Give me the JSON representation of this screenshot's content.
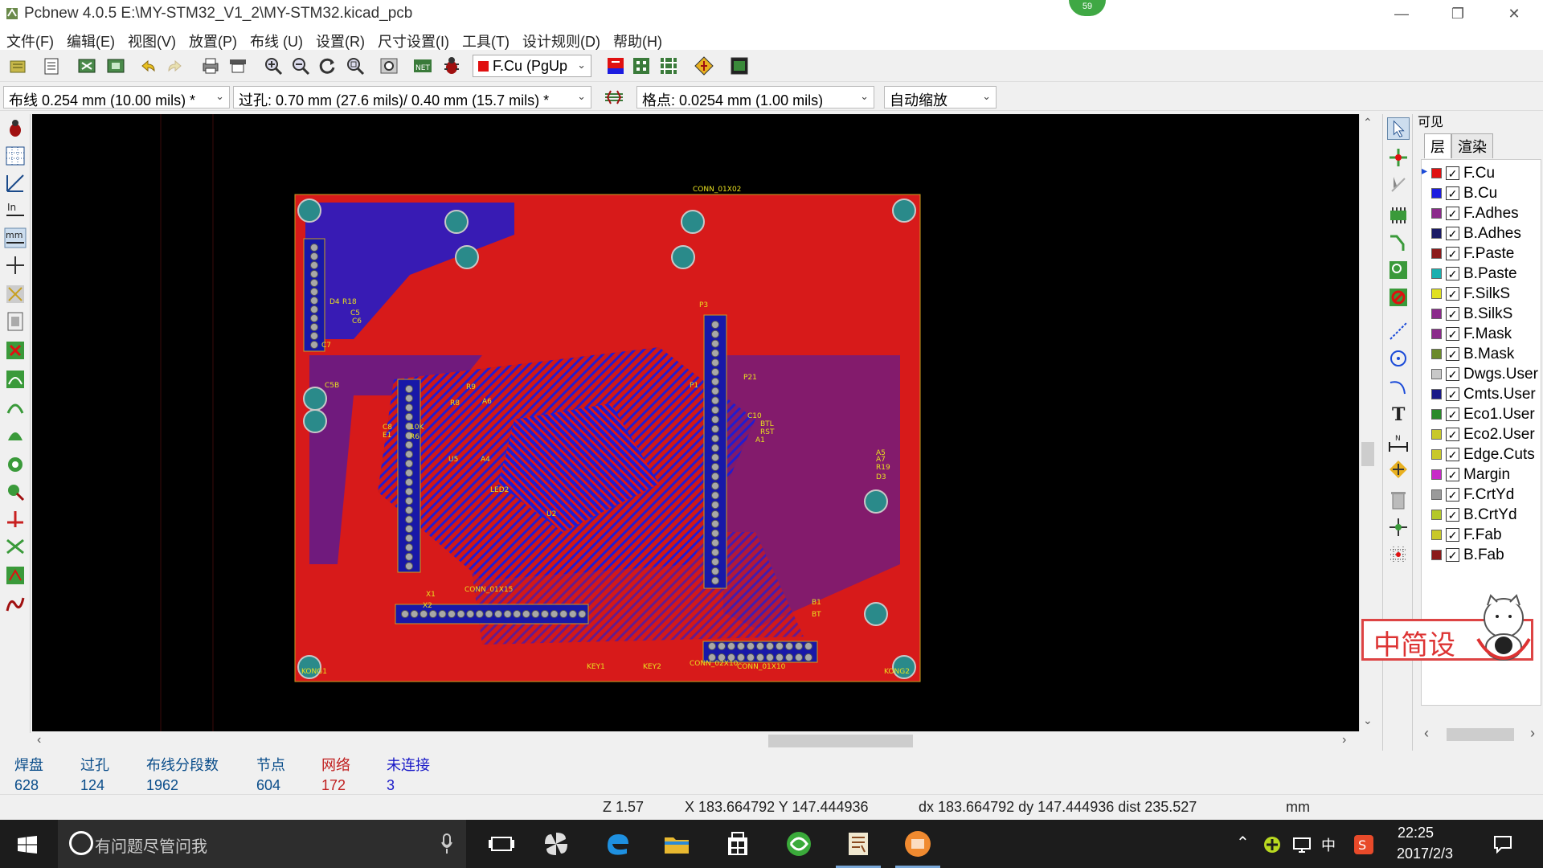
{
  "window": {
    "title": "Pcbnew 4.0.5 E:\\MY-STM32_V1_2\\MY-STM32.kicad_pcb",
    "notification_badge": "59"
  },
  "menu": [
    "文件(F)",
    "编辑(E)",
    "视图(V)",
    "放置(P)",
    "布线 (U)",
    "设置(R)",
    "尺寸设置(I)",
    "工具(T)",
    "设计规则(D)",
    "帮助(H)"
  ],
  "toolbar": {
    "active_layer": "F.Cu (PgUp",
    "active_layer_color": "#e01010"
  },
  "optionbar": {
    "track_width": "布线 0.254 mm (10.00 mils) *",
    "via_size": "过孔: 0.70 mm (27.6 mils)/ 0.40 mm (15.7 mils) *",
    "grid": "格点: 0.0254 mm (1.00 mils)",
    "zoom": "自动缩放"
  },
  "board": {
    "silk_labels": [
      "CONN_01X02",
      "CONN_01X10",
      "CONN_01X15",
      "CONN_02X10",
      "KONG1",
      "KONG2",
      "KEY1",
      "KEY2",
      "C10",
      "BTL",
      "RST",
      "A1",
      "P21",
      "P1",
      "P3",
      "A5",
      "A7",
      "R19",
      "D3",
      "D4",
      "R18",
      "C5",
      "C6",
      "C7",
      "C8",
      "E1",
      "U5",
      "A4",
      "A6",
      "X1",
      "X2",
      "R9",
      "R8",
      "C5B",
      "10K",
      "R6",
      "U2",
      "LED2",
      "B1",
      "BT"
    ]
  },
  "layer_panel": {
    "header": "可见",
    "tabs": [
      "层",
      "渲染"
    ],
    "layers": [
      {
        "name": "F.Cu",
        "color": "#e01010",
        "checked": true
      },
      {
        "name": "B.Cu",
        "color": "#1c1ce0",
        "checked": true
      },
      {
        "name": "F.Adhes",
        "color": "#8b2a8b",
        "checked": true
      },
      {
        "name": "B.Adhes",
        "color": "#1a1a66",
        "checked": true
      },
      {
        "name": "F.Paste",
        "color": "#8b1a1a",
        "checked": true
      },
      {
        "name": "B.Paste",
        "color": "#1ab0b0",
        "checked": true
      },
      {
        "name": "F.SilkS",
        "color": "#e0e020",
        "checked": true
      },
      {
        "name": "B.SilkS",
        "color": "#8b2a8b",
        "checked": true
      },
      {
        "name": "F.Mask",
        "color": "#8b2a8b",
        "checked": true
      },
      {
        "name": "B.Mask",
        "color": "#6b8a2a",
        "checked": true
      },
      {
        "name": "Dwgs.User",
        "color": "#c8c8c8",
        "checked": true
      },
      {
        "name": "Cmts.User",
        "color": "#1a1a88",
        "checked": true
      },
      {
        "name": "Eco1.User",
        "color": "#2a8a2a",
        "checked": true
      },
      {
        "name": "Eco2.User",
        "color": "#c8c82a",
        "checked": true
      },
      {
        "name": "Edge.Cuts",
        "color": "#c8c82a",
        "checked": true
      },
      {
        "name": "Margin",
        "color": "#c82ac8",
        "checked": true
      },
      {
        "name": "F.CrtYd",
        "color": "#9a9a9a",
        "checked": true
      },
      {
        "name": "B.CrtYd",
        "color": "#b4c82a",
        "checked": true
      },
      {
        "name": "F.Fab",
        "color": "#c8c82a",
        "checked": true
      },
      {
        "name": "B.Fab",
        "color": "#8b1a1a",
        "checked": true
      }
    ]
  },
  "stamp_text": "中简设",
  "message_panel": [
    {
      "label": "焊盘",
      "value": "628",
      "color": "#0a4d8a"
    },
    {
      "label": "过孔",
      "value": "124",
      "color": "#0a4d8a"
    },
    {
      "label": "布线分段数",
      "value": "1962",
      "color": "#0a4d8a"
    },
    {
      "label": "节点",
      "value": "604",
      "color": "#0a4d8a"
    },
    {
      "label": "网络",
      "value": "172",
      "color": "#c02020"
    },
    {
      "label": "未连接",
      "value": "3",
      "color": "#1a1ac8"
    }
  ],
  "statusbar": {
    "zoom": "Z 1.57",
    "xy": "X 183.664792  Y 147.444936",
    "delta": "dx 183.664792  dy 147.444936  dist 235.527",
    "units": "mm"
  },
  "taskbar": {
    "search_placeholder": "有问题尽管问我",
    "time": "22:25",
    "date": "2017/2/3",
    "ime": "中"
  }
}
